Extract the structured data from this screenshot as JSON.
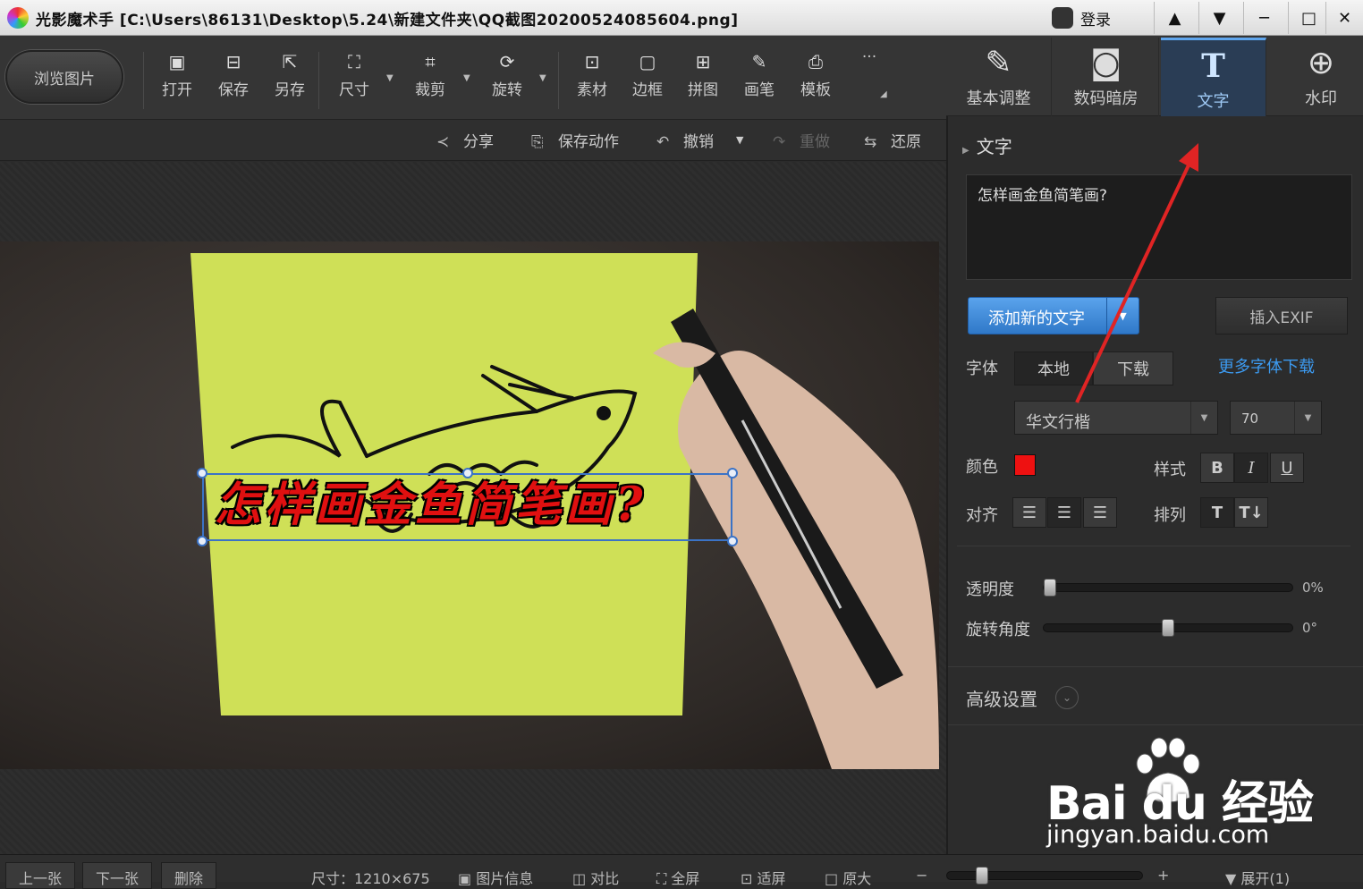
{
  "titlebar": {
    "title": "光影魔术手  [C:\\Users\\86131\\Desktop\\5.24\\新建文件夹\\QQ截图20200524085604.png]",
    "login": "登录",
    "controls": [
      "skin-icon",
      "menu-icon",
      "minimize-icon",
      "maximize-icon",
      "close-icon"
    ]
  },
  "toolbar": {
    "browse": "浏览图片",
    "tools": [
      {
        "label": "打开",
        "icon": "open-icon"
      },
      {
        "label": "保存",
        "icon": "save-icon"
      },
      {
        "label": "另存",
        "icon": "save-as-icon"
      },
      {
        "label": "尺寸",
        "icon": "resize-icon"
      },
      {
        "label": "裁剪",
        "icon": "crop-icon"
      },
      {
        "label": "旋转",
        "icon": "rotate-icon"
      },
      {
        "label": "素材",
        "icon": "material-icon"
      },
      {
        "label": "边框",
        "icon": "border-icon"
      },
      {
        "label": "拼图",
        "icon": "collage-icon"
      },
      {
        "label": "画笔",
        "icon": "brush-icon"
      },
      {
        "label": "模板",
        "icon": "template-icon"
      }
    ],
    "more": "···"
  },
  "actionbar": {
    "share": "分享",
    "save_action": "保存动作",
    "undo": "撤销",
    "redo": "重做",
    "restore": "还原"
  },
  "canvas": {
    "overlay_text": "怎样画金鱼简笔画?"
  },
  "right_tabs": [
    {
      "label": "基本调整",
      "icon": "edit-icon"
    },
    {
      "label": "数码暗房",
      "icon": "camera-icon"
    },
    {
      "label": "文字",
      "icon": "text-icon",
      "active": true
    },
    {
      "label": "水印",
      "icon": "watermark-icon"
    }
  ],
  "text_panel": {
    "section_title": "文字",
    "content": "怎样画金鱼简笔画?",
    "add_button": "添加新的文字",
    "exif_button": "插入EXIF",
    "font_label": "字体",
    "font_local": "本地",
    "font_download": "下载",
    "more_fonts": "更多字体下载",
    "font_name": "华文行楷",
    "font_size": "70",
    "color_label": "颜色",
    "color_value": "#ee1111",
    "style_label": "样式",
    "bold": "B",
    "italic": "I",
    "underline": "U",
    "align_label": "对齐",
    "arrange_label": "排列",
    "opacity_label": "透明度",
    "opacity_value": "0%",
    "opacity_level": 0,
    "rotation_label": "旋转角度",
    "rotation_value": "0°",
    "rotation_level": 0.5,
    "advanced_label": "高级设置"
  },
  "watermark": {
    "brand": "Bai du 经验",
    "url": "jingyan.baidu.com"
  },
  "statusbar": {
    "prev": "上一张",
    "next": "下一张",
    "delete": "删除",
    "size": "尺寸：1210×675",
    "info": "图片信息",
    "compare": "对比",
    "fullscreen": "全屏",
    "fit": "适屏",
    "original": "原大",
    "expand": "展开(1)"
  }
}
